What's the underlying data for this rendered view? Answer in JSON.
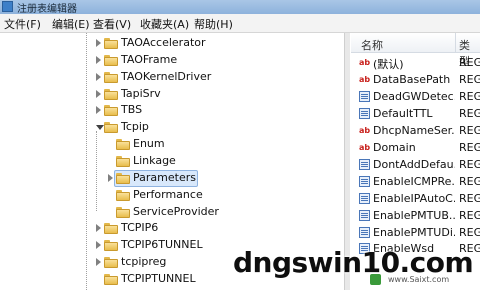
{
  "window": {
    "title": "注册表编辑器"
  },
  "menu": [
    "文件(F)",
    "编辑(E)",
    "查看(V)",
    "收藏夹(A)",
    "帮助(H)"
  ],
  "tree": [
    {
      "label": "TAOAccelerator",
      "level": 0,
      "expander": "collapsed",
      "selected": false
    },
    {
      "label": "TAOFrame",
      "level": 0,
      "expander": "collapsed",
      "selected": false
    },
    {
      "label": "TAOKernelDriver",
      "level": 0,
      "expander": "collapsed",
      "selected": false
    },
    {
      "label": "TapiSrv",
      "level": 0,
      "expander": "collapsed",
      "selected": false
    },
    {
      "label": "TBS",
      "level": 0,
      "expander": "collapsed",
      "selected": false
    },
    {
      "label": "Tcpip",
      "level": 0,
      "expander": "expanded",
      "selected": false
    },
    {
      "label": "Enum",
      "level": 1,
      "expander": "none",
      "selected": false
    },
    {
      "label": "Linkage",
      "level": 1,
      "expander": "none",
      "selected": false
    },
    {
      "label": "Parameters",
      "level": 1,
      "expander": "collapsed",
      "selected": true
    },
    {
      "label": "Performance",
      "level": 1,
      "expander": "none",
      "selected": false
    },
    {
      "label": "ServiceProvider",
      "level": 1,
      "expander": "none",
      "selected": false
    },
    {
      "label": "TCPIP6",
      "level": 0,
      "expander": "collapsed",
      "selected": false
    },
    {
      "label": "TCPIP6TUNNEL",
      "level": 0,
      "expander": "collapsed",
      "selected": false
    },
    {
      "label": "tcpipreg",
      "level": 0,
      "expander": "collapsed",
      "selected": false
    },
    {
      "label": "TCPIPTUNNEL",
      "level": 0,
      "expander": "none",
      "selected": false
    }
  ],
  "list": {
    "columns": {
      "name": "名称",
      "type": "类型"
    },
    "rows": [
      {
        "icon": "string-value-icon",
        "icon_text": "ab",
        "name": "(默认)",
        "type": "REG"
      },
      {
        "icon": "string-value-icon",
        "icon_text": "ab",
        "name": "DataBasePath",
        "type": "REG"
      },
      {
        "icon": "binary-value-icon",
        "icon_text": "",
        "name": "DeadGWDetec...",
        "type": "REG"
      },
      {
        "icon": "binary-value-icon",
        "icon_text": "",
        "name": "DefaultTTL",
        "type": "REG"
      },
      {
        "icon": "string-value-icon",
        "icon_text": "ab",
        "name": "DhcpNameSer...",
        "type": "REG"
      },
      {
        "icon": "string-value-icon",
        "icon_text": "ab",
        "name": "Domain",
        "type": "REG"
      },
      {
        "icon": "binary-value-icon",
        "icon_text": "",
        "name": "DontAddDefau...",
        "type": "REG"
      },
      {
        "icon": "binary-value-icon",
        "icon_text": "",
        "name": "EnableICMPRe...",
        "type": "REG"
      },
      {
        "icon": "binary-value-icon",
        "icon_text": "",
        "name": "EnableIPAutoC...",
        "type": "REG"
      },
      {
        "icon": "binary-value-icon",
        "icon_text": "",
        "name": "EnablePMTUB...",
        "type": "REG"
      },
      {
        "icon": "binary-value-icon",
        "icon_text": "",
        "name": "EnablePMTUDi...",
        "type": "REG"
      },
      {
        "icon": "binary-value-icon",
        "icon_text": "",
        "name": "EnableWsd",
        "type": "REG"
      }
    ]
  },
  "watermark": {
    "text": "dngswin10.com",
    "sub": "www.Saixt.com"
  }
}
